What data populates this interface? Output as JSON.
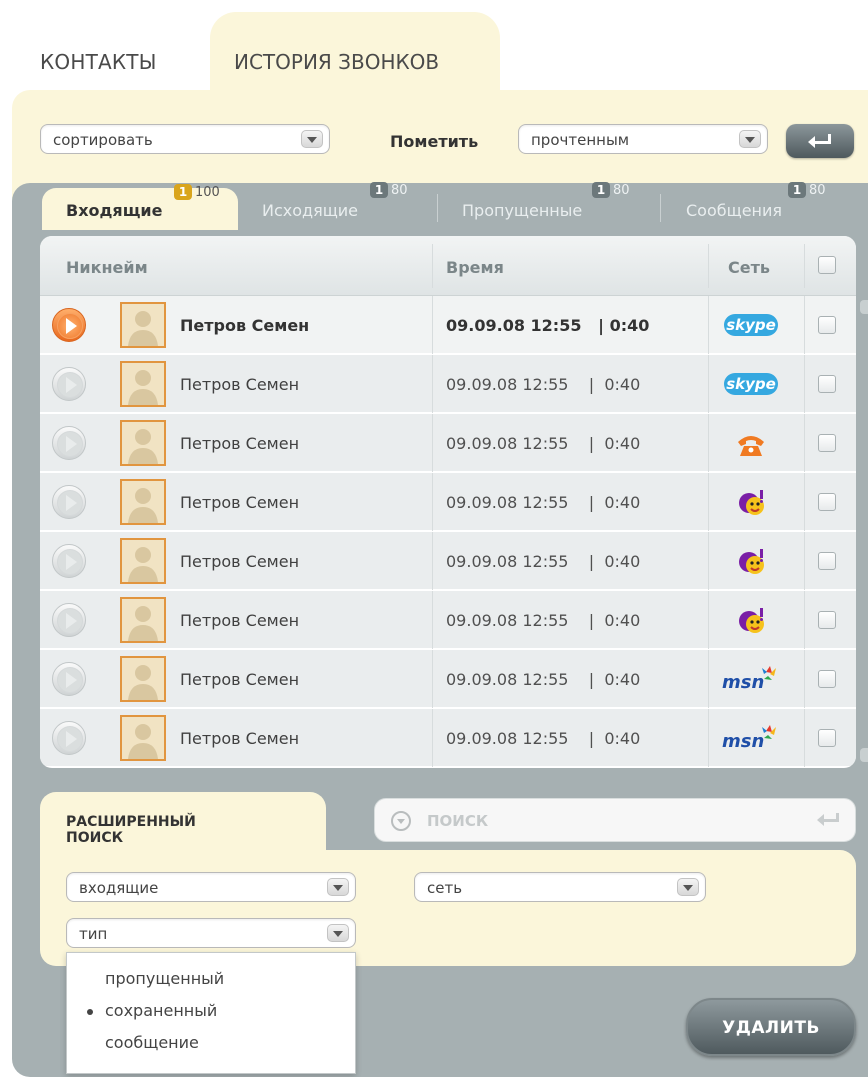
{
  "top_tabs": {
    "contacts": "КОНТАКТЫ",
    "history": "ИСТОРИЯ ЗВОНКОВ"
  },
  "toolbar": {
    "sort_value": "сортировать",
    "mark_label": "Пометить",
    "mark_value": "прочтенным"
  },
  "subtabs": [
    {
      "label": "Входящие",
      "badge": "1",
      "count": "100"
    },
    {
      "label": "Исходящие",
      "badge": "1",
      "count": "80"
    },
    {
      "label": "Пропущенные",
      "badge": "1",
      "count": "80"
    },
    {
      "label": "Сообщения",
      "badge": "1",
      "count": "80"
    }
  ],
  "table": {
    "headers": {
      "nick": "Никнейм",
      "time": "Время",
      "net": "Сеть"
    },
    "rows": [
      {
        "name": "Петров Семен",
        "time": "09.09.08 12:55   | 0:40",
        "network": "skype"
      },
      {
        "name": "Петров Семен",
        "time": "09.09.08 12:55    |  0:40",
        "network": "skype"
      },
      {
        "name": "Петров Семен",
        "time": "09.09.08 12:55    |  0:40",
        "network": "phone"
      },
      {
        "name": "Петров Семен",
        "time": "09.09.08 12:55    |  0:40",
        "network": "yahoo"
      },
      {
        "name": "Петров Семен",
        "time": "09.09.08 12:55    |  0:40",
        "network": "yahoo"
      },
      {
        "name": "Петров Семен",
        "time": "09.09.08 12:55    |  0:40",
        "network": "yahoo"
      },
      {
        "name": "Петров Семен",
        "time": "09.09.08 12:55    |  0:40",
        "network": "msn"
      },
      {
        "name": "Петров Семен",
        "time": "09.09.08 12:55    |  0:40",
        "network": "msn"
      }
    ]
  },
  "network_labels": {
    "skype": "skype",
    "msn": "msn"
  },
  "search": {
    "adv_label_1": "РАСШИРЕННЫЙ",
    "adv_label_2": "ПОИСК",
    "placeholder": "ПОИСК",
    "direction_value": "входящие",
    "network_value": "сеть",
    "type_value": "тип",
    "type_options": [
      "пропущенный",
      "сохраненный",
      "сообщение"
    ],
    "selected_option": "сохраненный"
  },
  "actions": {
    "delete": "УДАЛИТЬ"
  },
  "colors": {
    "accent_orange": "#e8691f",
    "panel_cream": "#fbf6da",
    "panel_grey": "#a6b0b2",
    "badge_gold": "#d9a51c"
  }
}
